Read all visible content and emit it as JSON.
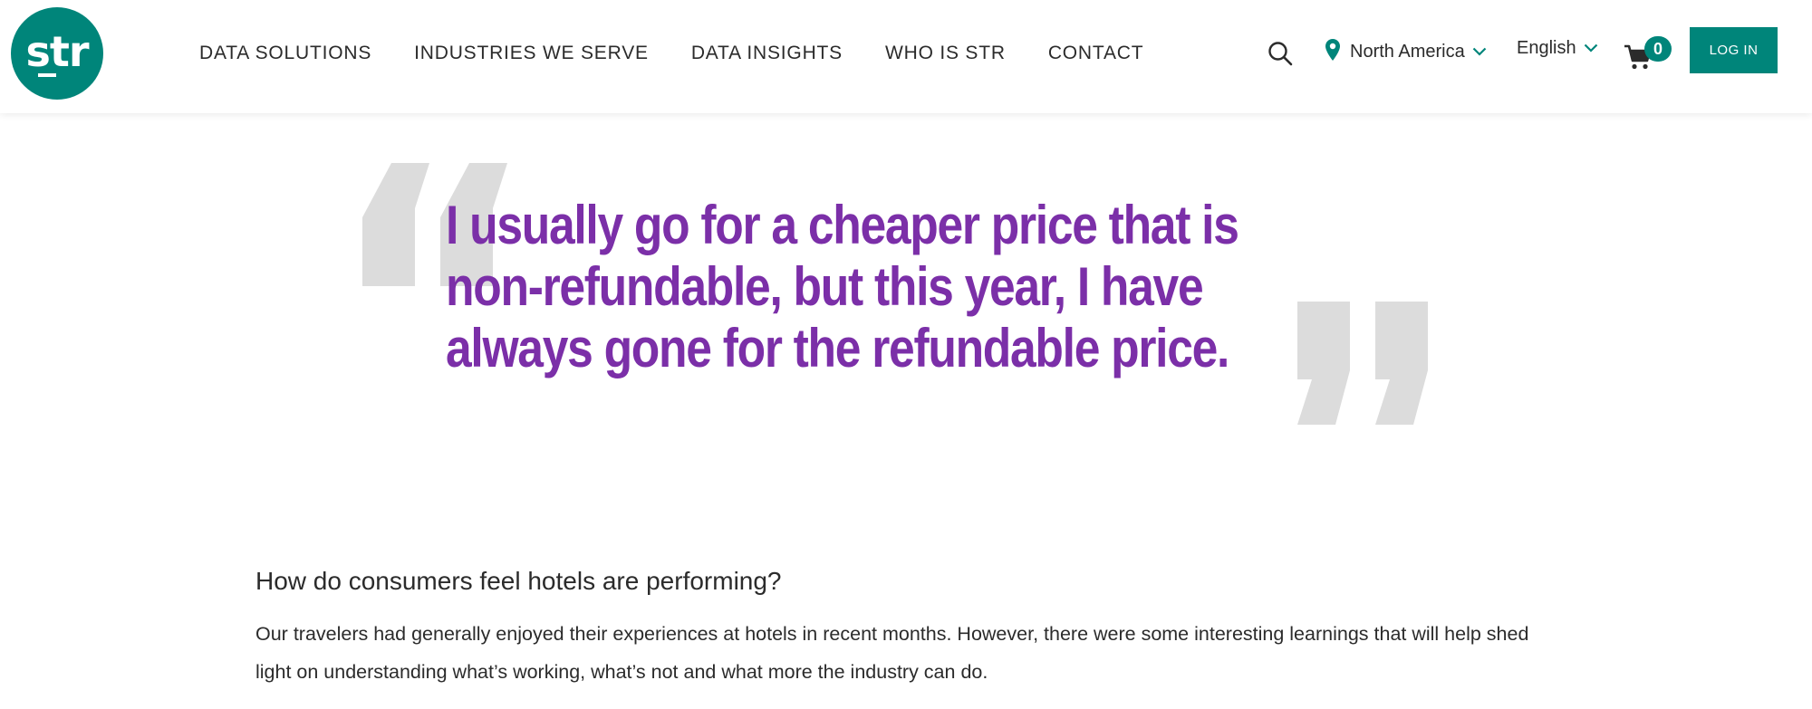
{
  "logo": {
    "text": "str",
    "color": "#00857a"
  },
  "nav": {
    "items": [
      {
        "label": "DATA SOLUTIONS"
      },
      {
        "label": "INDUSTRIES WE SERVE"
      },
      {
        "label": "DATA INSIGHTS"
      },
      {
        "label": "WHO IS STR"
      },
      {
        "label": "CONTACT"
      }
    ]
  },
  "header": {
    "search_icon": "search-icon",
    "region": {
      "label": "North America",
      "icon": "map-pin-icon"
    },
    "language": {
      "label": "English"
    },
    "cart": {
      "count": "0",
      "icon": "cart-icon"
    },
    "login_label": "LOG IN"
  },
  "quote": {
    "text": "I usually go for a cheaper price that is non-refundable, but this year, I have always gone for the refundable price.",
    "color": "#7b2fa8",
    "mark_color": "#dcdcdc"
  },
  "article": {
    "heading": "How do consumers feel hotels are performing?",
    "body": "Our travelers had generally enjoyed their experiences at hotels in recent months. However, there were some interesting learnings that will help shed light on understanding what’s working, what’s not and what more the industry can do."
  },
  "colors": {
    "accent": "#00857a",
    "text": "#2b2b2b"
  }
}
